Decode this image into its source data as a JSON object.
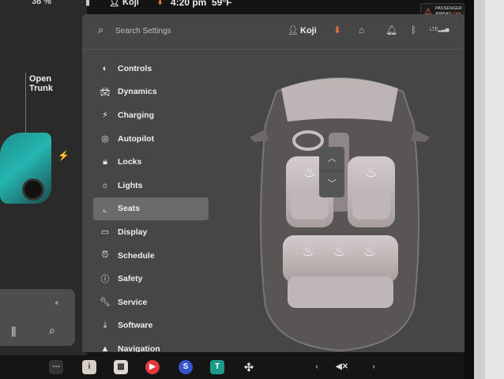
{
  "status_bar": {
    "battery": "36 %",
    "driver_name": "Koji",
    "time": "4:20 pm",
    "temperature": "59°F",
    "airbag_line1": "PASSENGER",
    "airbag_line2": "AIRBAG",
    "airbag_state": "OFF"
  },
  "background": {
    "open_trunk_label": "Open\nTrunk"
  },
  "settings": {
    "search_placeholder": "Search Settings",
    "profile_name": "Koji",
    "menu": [
      {
        "label": "Controls",
        "icon": "toggle-icon"
      },
      {
        "label": "Dynamics",
        "icon": "car-icon"
      },
      {
        "label": "Charging",
        "icon": "bolt-icon"
      },
      {
        "label": "Autopilot",
        "icon": "steering-wheel-icon"
      },
      {
        "label": "Locks",
        "icon": "lock-icon"
      },
      {
        "label": "Lights",
        "icon": "sun-icon"
      },
      {
        "label": "Seats",
        "icon": "seat-icon",
        "active": true
      },
      {
        "label": "Display",
        "icon": "display-icon"
      },
      {
        "label": "Schedule",
        "icon": "alarm-clock-icon"
      },
      {
        "label": "Safety",
        "icon": "info-circle-icon"
      },
      {
        "label": "Service",
        "icon": "wrench-icon"
      },
      {
        "label": "Software",
        "icon": "download-icon"
      },
      {
        "label": "Navigation",
        "icon": "navigation-arrow-icon"
      }
    ]
  },
  "colors": {
    "accent_orange": "#e8743b",
    "panel": "#464646",
    "active_item": "#6a6a6a"
  }
}
